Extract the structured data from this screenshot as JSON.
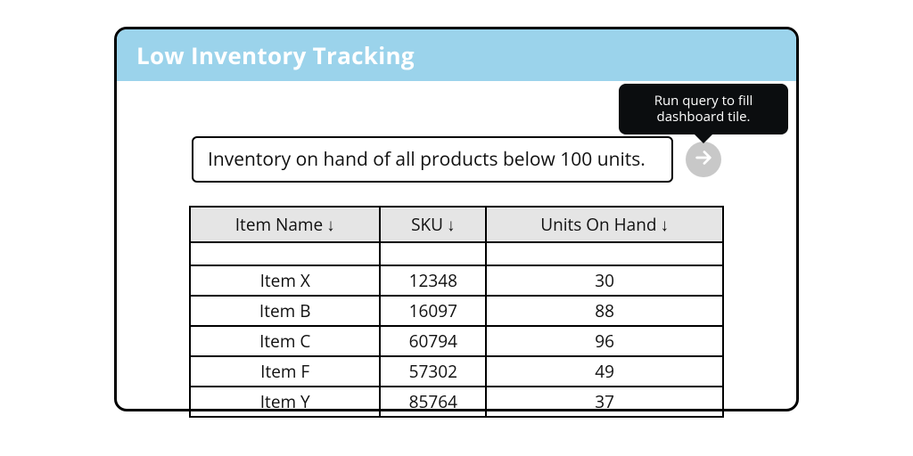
{
  "tile": {
    "title": "Low Inventory Tracking"
  },
  "query": {
    "text": "Inventory on hand of all products below 100 units.",
    "run_tooltip": "Run query to fill dashboard tile."
  },
  "table": {
    "columns": [
      {
        "label": "Item Name",
        "sort_indicator": "↓"
      },
      {
        "label": "SKU",
        "sort_indicator": "↓"
      },
      {
        "label": "Units On Hand",
        "sort_indicator": "↓"
      }
    ],
    "rows": [
      {
        "item_name": "Item X",
        "sku": "12348",
        "units": "30"
      },
      {
        "item_name": "Item B",
        "sku": "16097",
        "units": "88"
      },
      {
        "item_name": "Item C",
        "sku": "60794",
        "units": "96"
      },
      {
        "item_name": "Item F",
        "sku": "57302",
        "units": "49"
      },
      {
        "item_name": "Item Y",
        "sku": "85764",
        "units": "37"
      }
    ]
  }
}
